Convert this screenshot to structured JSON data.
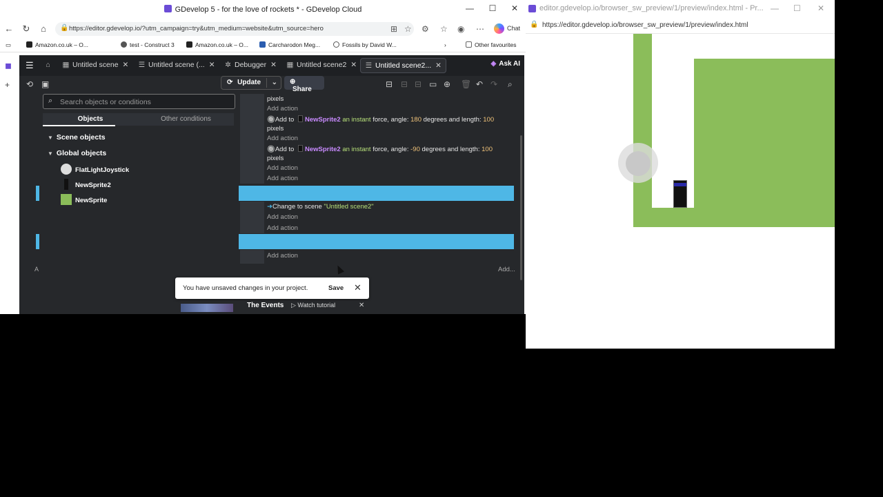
{
  "browser_left": {
    "window_title": "GDevelop 5 - for the love of rockets * - GDevelop Cloud",
    "url": "https://editor.gdevelop.io/?utm_campaign=try&utm_medium=website&utm_source=hero",
    "chat_label": "Chat",
    "bookmarks": [
      "Amazon.co.uk – O...",
      "test - Construct 3",
      "Amazon.co.uk – O...",
      "Carcharodon Meg...",
      "Fossils by David W..."
    ],
    "other_favourites": "Other favourites"
  },
  "gdevelop": {
    "tabs": [
      {
        "label": "Untitled scene"
      },
      {
        "label": "Untitled scene (..."
      },
      {
        "label": "Debugger"
      },
      {
        "label": "Untitled scene2"
      },
      {
        "label": "Untitled scene2..."
      }
    ],
    "ask_ai": "Ask AI",
    "toolbar": {
      "update": "Update",
      "share": "Share"
    },
    "objects_panel": {
      "search_placeholder": "Search objects or conditions",
      "tab_objects": "Objects",
      "tab_other": "Other conditions",
      "scene_objects": "Scene objects",
      "global_objects": "Global objects",
      "objects": [
        {
          "name": "FlatLightJoystick"
        },
        {
          "name": "NewSprite2"
        },
        {
          "name": "NewSprite"
        }
      ]
    },
    "events": {
      "pixels_label": "pixels",
      "add_action": "Add action",
      "action_add_to": "Add to",
      "object_name": "NewSprite2",
      "instant_force": "an instant",
      "force_angle_label": "force, angle:",
      "degrees_length_label": "degrees and length:",
      "angle1": "180",
      "angle2": "-90",
      "length": "100",
      "change_scene_label": "Change to scene",
      "scene_target": "\"Untitled scene2\"",
      "add_right": "Add...",
      "add_left": "A"
    },
    "toast": {
      "message": "You have unsaved changes in your project.",
      "save": "Save"
    },
    "tutorial": {
      "title": "The Events",
      "watch": "Watch tutorial"
    }
  },
  "browser_right": {
    "window_title": "editor.gdevelop.io/browser_sw_preview/1/preview/index.html - Pr...",
    "url": "https://editor.gdevelop.io/browser_sw_preview/1/preview/index.html"
  },
  "colors": {
    "event_bar": "#4eb7e6",
    "ground": "#8bbd5a",
    "object_highlight": "#c98bff"
  }
}
